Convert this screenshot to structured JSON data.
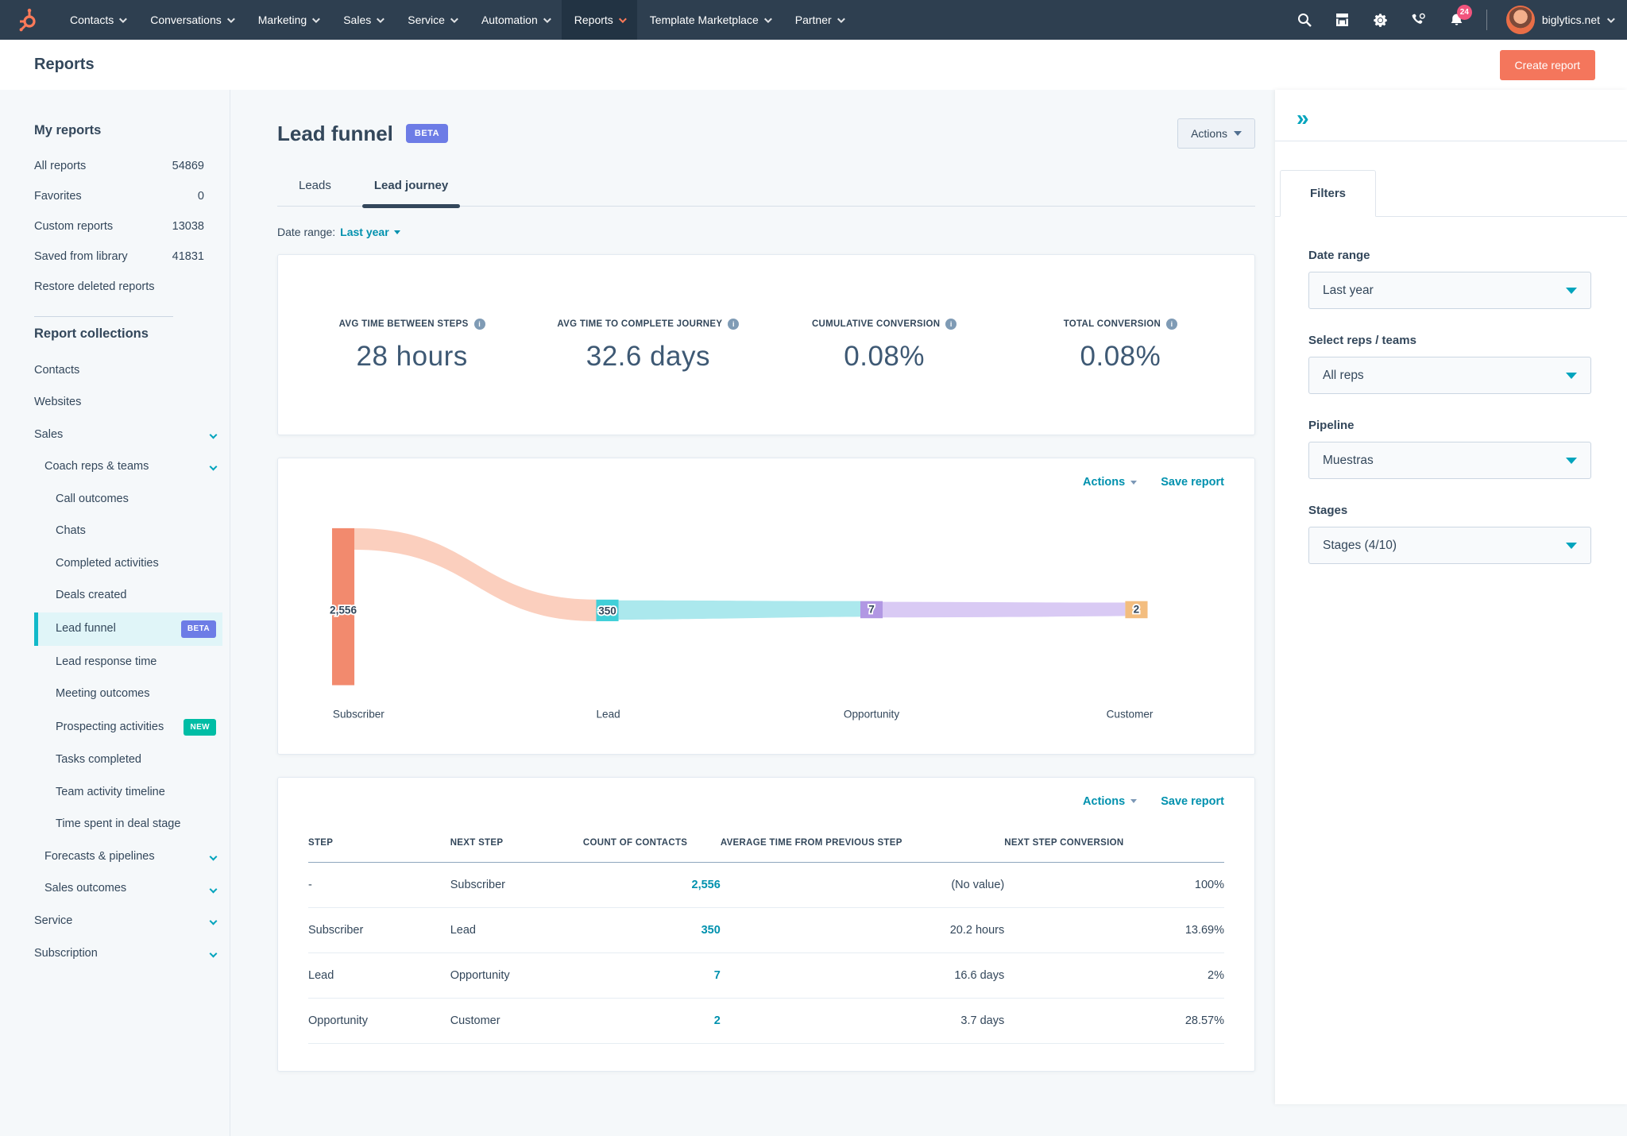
{
  "nav": {
    "items": [
      {
        "label": "Contacts"
      },
      {
        "label": "Conversations"
      },
      {
        "label": "Marketing"
      },
      {
        "label": "Sales"
      },
      {
        "label": "Service"
      },
      {
        "label": "Automation"
      },
      {
        "label": "Reports",
        "active": true
      },
      {
        "label": "Template Marketplace"
      },
      {
        "label": "Partner"
      }
    ],
    "notification_count": "24",
    "account": "biglytics.net"
  },
  "header": {
    "title": "Reports",
    "create_button": "Create report"
  },
  "sidebar": {
    "my_reports_title": "My reports",
    "my_reports": [
      {
        "label": "All reports",
        "count": "54869"
      },
      {
        "label": "Favorites",
        "count": "0"
      },
      {
        "label": "Custom reports",
        "count": "13038"
      },
      {
        "label": "Saved from library",
        "count": "41831"
      },
      {
        "label": "Restore deleted reports"
      }
    ],
    "collections_title": "Report collections",
    "collections": [
      {
        "label": "Contacts",
        "depth": "d0"
      },
      {
        "label": "Websites",
        "depth": "d0"
      },
      {
        "label": "Sales",
        "depth": "d0",
        "chevron": true
      },
      {
        "label": "Coach reps & teams",
        "depth": "d1",
        "chevron": true
      },
      {
        "label": "Call outcomes",
        "depth": "d2"
      },
      {
        "label": "Chats",
        "depth": "d2"
      },
      {
        "label": "Completed activities",
        "depth": "d2"
      },
      {
        "label": "Deals created",
        "depth": "d2"
      },
      {
        "label": "Lead funnel",
        "depth": "d2",
        "selected": true,
        "badge": "BETA",
        "badge_type": "beta"
      },
      {
        "label": "Lead response time",
        "depth": "d2"
      },
      {
        "label": "Meeting outcomes",
        "depth": "d2"
      },
      {
        "label": "Prospecting activities",
        "depth": "d2",
        "badge": "NEW",
        "badge_type": "new"
      },
      {
        "label": "Tasks completed",
        "depth": "d2"
      },
      {
        "label": "Team activity timeline",
        "depth": "d2"
      },
      {
        "label": "Time spent in deal stage",
        "depth": "d2"
      },
      {
        "label": "Forecasts & pipelines",
        "depth": "d1",
        "chevron": true
      },
      {
        "label": "Sales outcomes",
        "depth": "d1",
        "chevron": true
      },
      {
        "label": "Service",
        "depth": "d0",
        "chevron": true
      },
      {
        "label": "Subscription",
        "depth": "d0",
        "chevron": true
      }
    ]
  },
  "main": {
    "title": "Lead funnel",
    "beta_badge": "BETA",
    "actions_label": "Actions",
    "tabs": [
      {
        "label": "Leads"
      },
      {
        "label": "Lead journey",
        "active": true
      }
    ],
    "date_range_label": "Date range:",
    "date_range_value": "Last year",
    "metrics": [
      {
        "label": "AVG TIME BETWEEN STEPS",
        "value": "28 hours"
      },
      {
        "label": "AVG TIME TO COMPLETE JOURNEY",
        "value": "32.6 days"
      },
      {
        "label": "CUMULATIVE CONVERSION",
        "value": "0.08%"
      },
      {
        "label": "TOTAL CONVERSION",
        "value": "0.08%"
      }
    ],
    "chart_actions_label": "Actions",
    "save_report_label": "Save report",
    "table": {
      "headers": [
        "STEP",
        "NEXT STEP",
        "COUNT OF CONTACTS",
        "AVERAGE TIME FROM PREVIOUS STEP",
        "NEXT STEP CONVERSION"
      ],
      "rows": [
        {
          "step": "-",
          "next": "Subscriber",
          "count": "2,556",
          "time": "(No value)",
          "conv": "100%"
        },
        {
          "step": "Subscriber",
          "next": "Lead",
          "count": "350",
          "time": "20.2 hours",
          "conv": "13.69%"
        },
        {
          "step": "Lead",
          "next": "Opportunity",
          "count": "7",
          "time": "16.6 days",
          "conv": "2%"
        },
        {
          "step": "Opportunity",
          "next": "Customer",
          "count": "2",
          "time": "3.7 days",
          "conv": "28.57%"
        }
      ]
    }
  },
  "chart_data": {
    "type": "sankey",
    "title": "Lead journey funnel",
    "stages": [
      "Subscriber",
      "Lead",
      "Opportunity",
      "Customer"
    ],
    "nodes": [
      {
        "label": "Subscriber",
        "value": 2556,
        "value_label": "2,556",
        "color": "#f28a6e"
      },
      {
        "label": "Lead",
        "value": 350,
        "value_label": "350",
        "color": "#40cfd8"
      },
      {
        "label": "Opportunity",
        "value": 7,
        "value_label": "7",
        "color": "#b197e3"
      },
      {
        "label": "Customer",
        "value": 2,
        "value_label": "2",
        "color": "#f3bd7f"
      }
    ],
    "flows": [
      {
        "from": "Subscriber",
        "to": "Lead",
        "value": 350,
        "color": "#fbcfbe"
      },
      {
        "from": "Lead",
        "to": "Opportunity",
        "value": 7,
        "color": "#abe8ed"
      },
      {
        "from": "Opportunity",
        "to": "Customer",
        "value": 2,
        "color": "#d9caf4"
      }
    ]
  },
  "filters_panel": {
    "collapse_icon": "»",
    "tab_label": "Filters",
    "groups": [
      {
        "label": "Date range",
        "value": "Last year"
      },
      {
        "label": "Select reps / teams",
        "value": "All reps"
      },
      {
        "label": "Pipeline",
        "value": "Muestras"
      },
      {
        "label": "Stages",
        "value": "Stages (4/10)"
      }
    ]
  }
}
